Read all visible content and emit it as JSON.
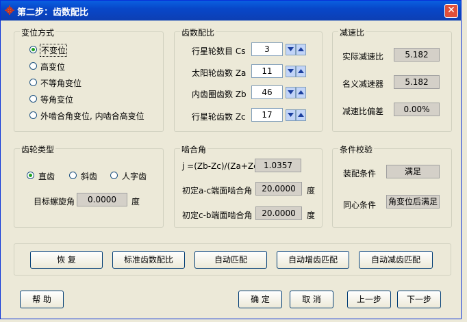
{
  "window": {
    "title": "第二步：齿数配比",
    "close_glyph": "✕"
  },
  "shift_mode": {
    "title": "变位方式",
    "options": [
      "不变位",
      "高变位",
      "不等角变位",
      "等角变位",
      "外啮合角变位, 内啮合高变位"
    ],
    "selected": 0
  },
  "gear_ratio": {
    "title": "齿数配比",
    "rows": [
      {
        "label": "行星轮数目 Cs",
        "value": "3"
      },
      {
        "label": "太阳轮齿数 Za",
        "value": "11"
      },
      {
        "label": "内齿圈齿数 Zb",
        "value": "46"
      },
      {
        "label": "行星轮齿数 Zc",
        "value": "17"
      }
    ]
  },
  "reduction": {
    "title": "减速比",
    "rows": [
      {
        "label": "实际减速比",
        "value": "5.182"
      },
      {
        "label": "名义减速器",
        "value": "5.182"
      },
      {
        "label": "减速比偏差",
        "value": "0.00%"
      }
    ]
  },
  "gear_type": {
    "title": "齿轮类型",
    "options": [
      "直齿",
      "斜齿",
      "人字齿"
    ],
    "selected": 0,
    "helix_label": "目标螺旋角",
    "helix_value": "0.0000",
    "helix_unit": "度"
  },
  "mesh_angle": {
    "title": "啮合角",
    "j_label": "j =(Zb-Zc)/(Za+Zc)",
    "j_value": "1.0357",
    "ac_label": "初定a-c端面啮合角",
    "ac_value": "20.0000",
    "cb_label": "初定c-b端面啮合角",
    "cb_value": "20.0000",
    "unit": "度"
  },
  "conditions": {
    "title": "条件校验",
    "assembly_label": "装配条件",
    "assembly_value": "满足",
    "concentric_label": "同心条件",
    "concentric_value": "角变位后满足"
  },
  "actions": [
    "恢 复",
    "标准齿数配比",
    "自动匹配",
    "自动增齿匹配",
    "自动减齿匹配"
  ],
  "footer": {
    "help": "帮 助",
    "ok": "确 定",
    "cancel": "取 消",
    "prev": "上一步",
    "next": "下一步"
  },
  "colors": {
    "titlebar": "#0a5fe0",
    "face": "#ece9d8",
    "close": "#e0503a"
  }
}
